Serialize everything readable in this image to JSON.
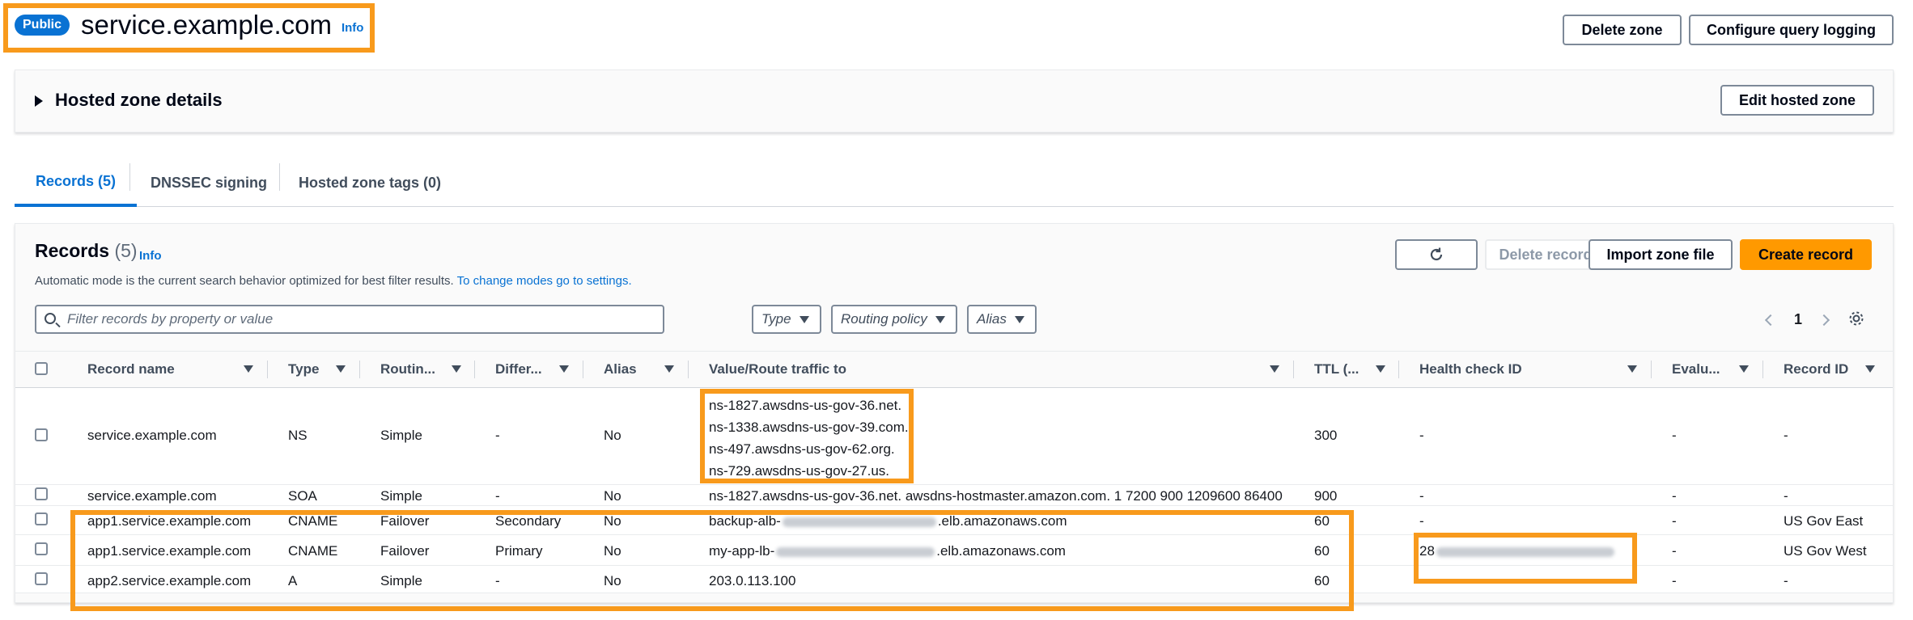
{
  "header": {
    "badge": "Public",
    "zone_name": "service.example.com",
    "info": "Info",
    "delete_zone": "Delete zone",
    "configure_logging": "Configure query logging"
  },
  "details": {
    "title": "Hosted zone details",
    "edit_button": "Edit hosted zone"
  },
  "tabs": [
    {
      "label": "Records (5)",
      "active": true
    },
    {
      "label": "DNSSEC signing",
      "active": false
    },
    {
      "label": "Hosted zone tags (0)",
      "active": false
    }
  ],
  "records_panel": {
    "title": "Records",
    "count": "(5)",
    "info": "Info",
    "description": "Automatic mode is the current search behavior optimized for best filter results.",
    "settings_link": "To change modes go to settings.",
    "delete_record": "Delete record",
    "import_zone": "Import zone file",
    "create_record": "Create record",
    "search_placeholder": "Filter records by property or value",
    "filters": [
      "Type",
      "Routing policy",
      "Alias"
    ],
    "page": "1"
  },
  "columns": [
    "Record name",
    "Type",
    "Routin...",
    "Differ...",
    "Alias",
    "Value/Route traffic to",
    "TTL (...",
    "Health check ID",
    "Evalu...",
    "Record ID"
  ],
  "rows": [
    {
      "name": "service.example.com",
      "type": "NS",
      "routing": "Simple",
      "differ": "-",
      "alias": "No",
      "value_lines": [
        "ns-1827.awsdns-us-gov-36.net.",
        "ns-1338.awsdns-us-gov-39.com.",
        "ns-497.awsdns-us-gov-62.org.",
        "ns-729.awsdns-us-gov-27.us."
      ],
      "ttl": "300",
      "health": "-",
      "evaluate": "-",
      "record_id": "-"
    },
    {
      "name": "service.example.com",
      "type": "SOA",
      "routing": "Simple",
      "differ": "-",
      "alias": "No",
      "value": "ns-1827.awsdns-us-gov-36.net. awsdns-hostmaster.amazon.com. 1 7200 900 1209600 86400",
      "ttl": "900",
      "health": "-",
      "evaluate": "-",
      "record_id": "-"
    },
    {
      "name": "app1.service.example.com",
      "type": "CNAME",
      "routing": "Failover",
      "differ": "Secondary",
      "alias": "No",
      "value_prefix": "backup-alb-",
      "value_suffix": ".elb.amazonaws.com",
      "ttl": "60",
      "health": "-",
      "evaluate": "-",
      "record_id": "US Gov East"
    },
    {
      "name": "app1.service.example.com",
      "type": "CNAME",
      "routing": "Failover",
      "differ": "Primary",
      "alias": "No",
      "value_prefix": "my-app-lb-",
      "value_suffix": ".elb.amazonaws.com",
      "ttl": "60",
      "health_prefix": "28",
      "evaluate": "-",
      "record_id": "US Gov West"
    },
    {
      "name": "app2.service.example.com",
      "type": "A",
      "routing": "Simple",
      "differ": "-",
      "alias": "No",
      "value": "203.0.113.100",
      "ttl": "60",
      "health": "-",
      "evaluate": "-",
      "record_id": "-"
    }
  ],
  "colors": {
    "accent": "#0972d3",
    "primary_button": "#ff9900",
    "highlight": "#f89a1c"
  },
  "icons": [
    "refresh-icon",
    "search-icon",
    "settings-gear-icon",
    "chevron-left-icon",
    "chevron-right-icon",
    "caret-right-icon",
    "sort-down-icon"
  ]
}
